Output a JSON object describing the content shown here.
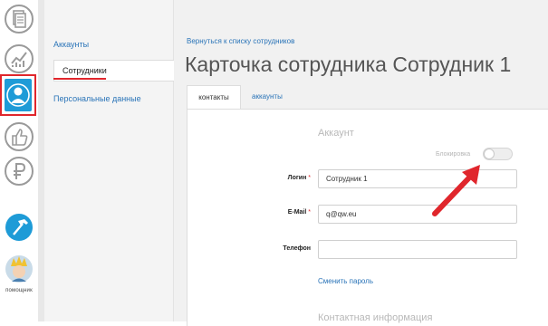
{
  "rail": {
    "assistant_label": "помощник"
  },
  "submenu": {
    "items": [
      {
        "label": "Аккаунты"
      },
      {
        "label": "Сотрудники"
      },
      {
        "label": "Персональные данные"
      }
    ]
  },
  "content": {
    "back_link": "Вернуться к списку сотрудников",
    "title": "Карточка сотрудника Сотрудник 1",
    "tabs": [
      {
        "label": "контакты"
      },
      {
        "label": "аккаунты"
      }
    ],
    "section_account": "Аккаунт",
    "block_label": "Блокировка",
    "fields": {
      "login": {
        "label": "Логин",
        "required": "*",
        "value": "Сотрудник 1"
      },
      "email": {
        "label": "E-Mail",
        "required": "*",
        "value": "q@qw.eu"
      },
      "phone": {
        "label": "Телефон",
        "value": ""
      }
    },
    "change_password": "Сменить пароль",
    "section_contact": "Контактная информация"
  },
  "colors": {
    "accent_red": "#e0262c",
    "link_blue": "#2a74b8",
    "active_user_bg": "#1e9bd7"
  }
}
